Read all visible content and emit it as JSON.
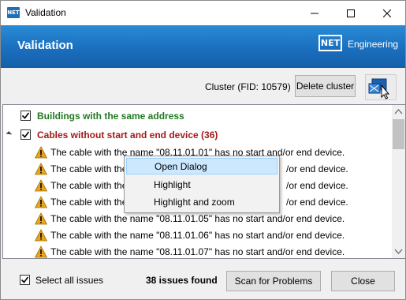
{
  "window": {
    "title": "Validation",
    "app_icon_text": "NET"
  },
  "header": {
    "title": "Validation",
    "logo_box": "NET",
    "logo_text": "Engineering",
    "background_color": "#1a6fbf"
  },
  "cluster": {
    "label": "Cluster (FID: 10579)",
    "delete_button": "Delete cluster",
    "identify_icon": "select-features-icon"
  },
  "tree": {
    "groups": [
      {
        "label": "Buildings with the same address",
        "checked": true,
        "color": "#1f7a1f"
      },
      {
        "label": "Cables without start and end device (36)",
        "checked": true,
        "expanded": true,
        "color": "#a11a1a"
      }
    ],
    "issues": [
      "The cable with the name \"08.11.01.01\" has no start and/or end device.",
      "The cable with the",
      "The cable with the",
      "The cable with the",
      "The cable with the name \"08.11.01.05\" has no start and/or end device.",
      "The cable with the name \"08.11.01.06\" has no start and/or end device.",
      "The cable with the name \"08.11.01.07\" has no start and/or end device."
    ],
    "issue_suffix": "/or end device."
  },
  "context_menu": {
    "items": [
      "Open Dialog",
      "Highlight",
      "Highlight and zoom"
    ],
    "highlighted_index": 0
  },
  "footer": {
    "select_all_label": "Select all issues",
    "select_all_checked": true,
    "issues_found": "38 issues found",
    "scan_button": "Scan for Problems",
    "close_button": "Close"
  }
}
